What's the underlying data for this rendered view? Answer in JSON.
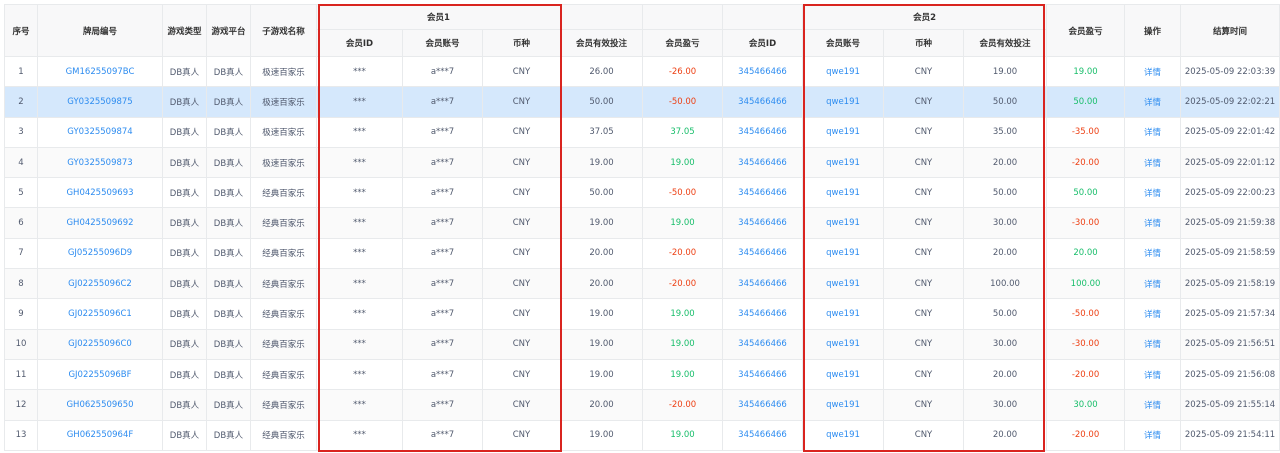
{
  "headers": {
    "index": "序号",
    "table_no": "牌局编号",
    "game_type": "游戏类型",
    "platform": "游戏平台",
    "sub_game": "子游戏名称",
    "member1": "会员1",
    "member2": "会员2",
    "member_id": "会员ID",
    "account": "会员账号",
    "currency": "币种",
    "valid_bet": "会员有效投注",
    "profit": "会员盈亏",
    "action": "操作",
    "settle_time": "结算时间"
  },
  "rows": [
    {
      "idx": "1",
      "no": "GM16255097BC",
      "type": "DB真人",
      "plat": "DB真人",
      "game": "极速百家乐",
      "m1id": "***",
      "m1acc": "a***7",
      "m1cur": "CNY",
      "m1bet": "26.00",
      "m1pl": "-26.00",
      "m1sign": "neg",
      "m2id": "345466466",
      "m2acc": "qwe191",
      "m2cur": "CNY",
      "m2bet": "19.00",
      "m2pl": "19.00",
      "m2sign": "pos",
      "act": "详情",
      "time": "2025-05-09 22:03:39"
    },
    {
      "idx": "2",
      "no": "GY0325509875",
      "type": "DB真人",
      "plat": "DB真人",
      "game": "极速百家乐",
      "m1id": "***",
      "m1acc": "a***7",
      "m1cur": "CNY",
      "m1bet": "50.00",
      "m1pl": "-50.00",
      "m1sign": "neg",
      "m2id": "345466466",
      "m2acc": "qwe191",
      "m2cur": "CNY",
      "m2bet": "50.00",
      "m2pl": "50.00",
      "m2sign": "pos",
      "act": "详情",
      "time": "2025-05-09 22:02:21"
    },
    {
      "idx": "3",
      "no": "GY0325509874",
      "type": "DB真人",
      "plat": "DB真人",
      "game": "极速百家乐",
      "m1id": "***",
      "m1acc": "a***7",
      "m1cur": "CNY",
      "m1bet": "37.05",
      "m1pl": "37.05",
      "m1sign": "pos",
      "m2id": "345466466",
      "m2acc": "qwe191",
      "m2cur": "CNY",
      "m2bet": "35.00",
      "m2pl": "-35.00",
      "m2sign": "neg",
      "act": "详情",
      "time": "2025-05-09 22:01:42"
    },
    {
      "idx": "4",
      "no": "GY0325509873",
      "type": "DB真人",
      "plat": "DB真人",
      "game": "极速百家乐",
      "m1id": "***",
      "m1acc": "a***7",
      "m1cur": "CNY",
      "m1bet": "19.00",
      "m1pl": "19.00",
      "m1sign": "pos",
      "m2id": "345466466",
      "m2acc": "qwe191",
      "m2cur": "CNY",
      "m2bet": "20.00",
      "m2pl": "-20.00",
      "m2sign": "neg",
      "act": "详情",
      "time": "2025-05-09 22:01:12"
    },
    {
      "idx": "5",
      "no": "GH0425509693",
      "type": "DB真人",
      "plat": "DB真人",
      "game": "经典百家乐",
      "m1id": "***",
      "m1acc": "a***7",
      "m1cur": "CNY",
      "m1bet": "50.00",
      "m1pl": "-50.00",
      "m1sign": "neg",
      "m2id": "345466466",
      "m2acc": "qwe191",
      "m2cur": "CNY",
      "m2bet": "50.00",
      "m2pl": "50.00",
      "m2sign": "pos",
      "act": "详情",
      "time": "2025-05-09 22:00:23"
    },
    {
      "idx": "6",
      "no": "GH0425509692",
      "type": "DB真人",
      "plat": "DB真人",
      "game": "经典百家乐",
      "m1id": "***",
      "m1acc": "a***7",
      "m1cur": "CNY",
      "m1bet": "19.00",
      "m1pl": "19.00",
      "m1sign": "pos",
      "m2id": "345466466",
      "m2acc": "qwe191",
      "m2cur": "CNY",
      "m2bet": "30.00",
      "m2pl": "-30.00",
      "m2sign": "neg",
      "act": "详情",
      "time": "2025-05-09 21:59:38"
    },
    {
      "idx": "7",
      "no": "GJ05255096D9",
      "type": "DB真人",
      "plat": "DB真人",
      "game": "经典百家乐",
      "m1id": "***",
      "m1acc": "a***7",
      "m1cur": "CNY",
      "m1bet": "20.00",
      "m1pl": "-20.00",
      "m1sign": "neg",
      "m2id": "345466466",
      "m2acc": "qwe191",
      "m2cur": "CNY",
      "m2bet": "20.00",
      "m2pl": "20.00",
      "m2sign": "pos",
      "act": "详情",
      "time": "2025-05-09 21:58:59"
    },
    {
      "idx": "8",
      "no": "GJ02255096C2",
      "type": "DB真人",
      "plat": "DB真人",
      "game": "经典百家乐",
      "m1id": "***",
      "m1acc": "a***7",
      "m1cur": "CNY",
      "m1bet": "20.00",
      "m1pl": "-20.00",
      "m1sign": "neg",
      "m2id": "345466466",
      "m2acc": "qwe191",
      "m2cur": "CNY",
      "m2bet": "100.00",
      "m2pl": "100.00",
      "m2sign": "pos",
      "act": "详情",
      "time": "2025-05-09 21:58:19"
    },
    {
      "idx": "9",
      "no": "GJ02255096C1",
      "type": "DB真人",
      "plat": "DB真人",
      "game": "经典百家乐",
      "m1id": "***",
      "m1acc": "a***7",
      "m1cur": "CNY",
      "m1bet": "19.00",
      "m1pl": "19.00",
      "m1sign": "pos",
      "m2id": "345466466",
      "m2acc": "qwe191",
      "m2cur": "CNY",
      "m2bet": "50.00",
      "m2pl": "-50.00",
      "m2sign": "neg",
      "act": "详情",
      "time": "2025-05-09 21:57:34"
    },
    {
      "idx": "10",
      "no": "GJ02255096C0",
      "type": "DB真人",
      "plat": "DB真人",
      "game": "经典百家乐",
      "m1id": "***",
      "m1acc": "a***7",
      "m1cur": "CNY",
      "m1bet": "19.00",
      "m1pl": "19.00",
      "m1sign": "pos",
      "m2id": "345466466",
      "m2acc": "qwe191",
      "m2cur": "CNY",
      "m2bet": "30.00",
      "m2pl": "-30.00",
      "m2sign": "neg",
      "act": "详情",
      "time": "2025-05-09 21:56:51"
    },
    {
      "idx": "11",
      "no": "GJ02255096BF",
      "type": "DB真人",
      "plat": "DB真人",
      "game": "经典百家乐",
      "m1id": "***",
      "m1acc": "a***7",
      "m1cur": "CNY",
      "m1bet": "19.00",
      "m1pl": "19.00",
      "m1sign": "pos",
      "m2id": "345466466",
      "m2acc": "qwe191",
      "m2cur": "CNY",
      "m2bet": "20.00",
      "m2pl": "-20.00",
      "m2sign": "neg",
      "act": "详情",
      "time": "2025-05-09 21:56:08"
    },
    {
      "idx": "12",
      "no": "GH0625509650",
      "type": "DB真人",
      "plat": "DB真人",
      "game": "经典百家乐",
      "m1id": "***",
      "m1acc": "a***7",
      "m1cur": "CNY",
      "m1bet": "20.00",
      "m1pl": "-20.00",
      "m1sign": "neg",
      "m2id": "345466466",
      "m2acc": "qwe191",
      "m2cur": "CNY",
      "m2bet": "30.00",
      "m2pl": "30.00",
      "m2sign": "pos",
      "act": "详情",
      "time": "2025-05-09 21:55:14"
    },
    {
      "idx": "13",
      "no": "GH062550964F",
      "type": "DB真人",
      "plat": "DB真人",
      "game": "经典百家乐",
      "m1id": "***",
      "m1acc": "a***7",
      "m1cur": "CNY",
      "m1bet": "19.00",
      "m1pl": "19.00",
      "m1sign": "pos",
      "m2id": "345466466",
      "m2acc": "qwe191",
      "m2cur": "CNY",
      "m2bet": "20.00",
      "m2pl": "-20.00",
      "m2sign": "neg",
      "act": "详情",
      "time": "2025-05-09 21:54:11"
    }
  ],
  "selected_row": 2
}
